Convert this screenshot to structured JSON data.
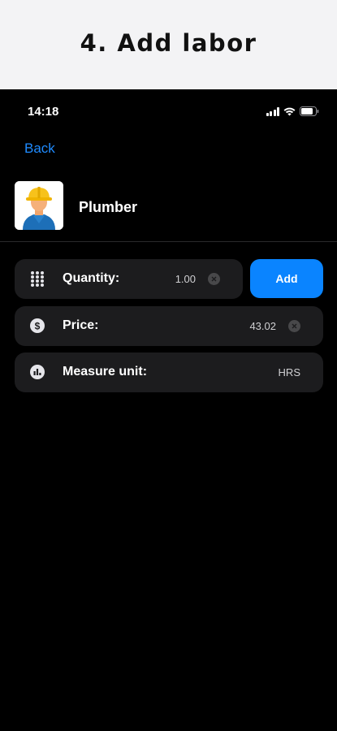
{
  "banner": {
    "title": "4. Add labor"
  },
  "status_bar": {
    "time": "14:18"
  },
  "nav": {
    "back_label": "Back"
  },
  "item": {
    "name": "Plumber",
    "avatar_icon": "plumber-worker-icon"
  },
  "fields": {
    "quantity": {
      "label": "Quantity:",
      "value": "1.00",
      "icon": "keypad-icon"
    },
    "price": {
      "label": "Price:",
      "value": "43.02",
      "icon": "dollar-icon"
    },
    "measure_unit": {
      "label": "Measure unit:",
      "value": "HRS",
      "icon": "chart-icon"
    }
  },
  "actions": {
    "add_label": "Add"
  },
  "colors": {
    "accent": "#0a84ff",
    "row_bg": "#1c1c1e",
    "background": "#000000"
  }
}
